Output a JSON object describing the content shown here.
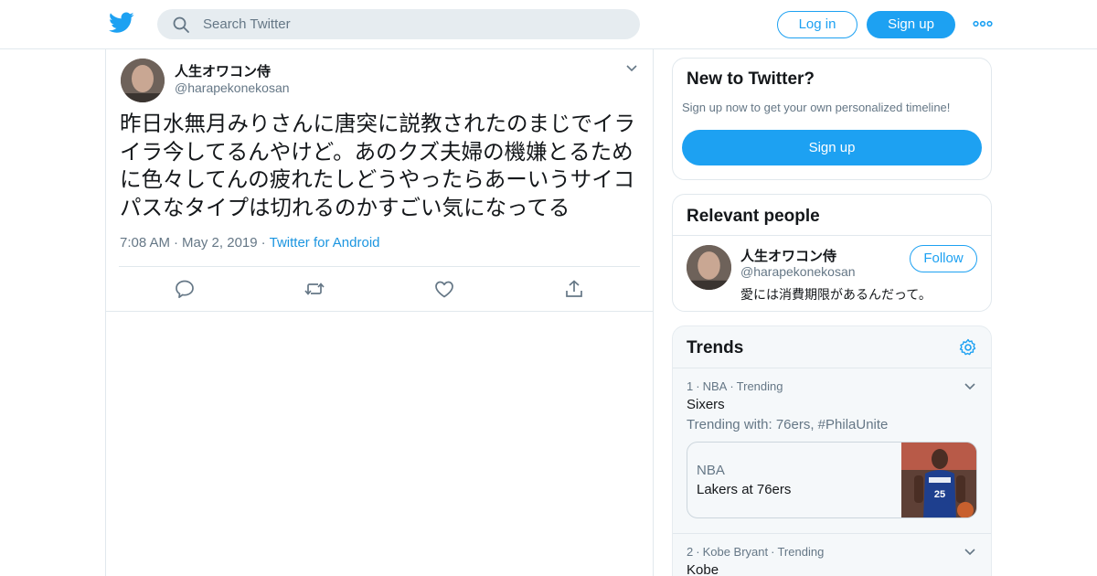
{
  "header": {
    "logo_icon": "twitter-bird-icon",
    "search": {
      "placeholder": "Search Twitter",
      "value": ""
    },
    "login_label": "Log in",
    "signup_label": "Sign up",
    "more_icon": "more-dots-icon"
  },
  "tweet": {
    "display_name": "人生オワコン侍",
    "handle": "@harapekonekosan",
    "text": "昨日水無月みりさんに唐突に説教されたのまじでイライラ今してるんやけど。あのクズ夫婦の機嫌とるために色々してんの疲れたしどうやったらあーいうサイコパスなタイプは切れるのかすごい気になってる",
    "time": "7:08 AM",
    "date": "May 2, 2019",
    "source": "Twitter for Android",
    "actions": [
      "reply-icon",
      "retweet-icon",
      "like-icon",
      "share-icon"
    ]
  },
  "sidebar": {
    "new_to_twitter": {
      "title": "New to Twitter?",
      "subtitle": "Sign up now to get your own personalized timeline!",
      "button_label": "Sign up"
    },
    "relevant_people": {
      "title": "Relevant people",
      "person": {
        "display_name": "人生オワコン侍",
        "handle": "@harapekonekosan",
        "bio": "愛には消費期限があるんだって。",
        "follow_label": "Follow"
      }
    },
    "trends": {
      "title": "Trends",
      "items": [
        {
          "rank": "1",
          "category": "NBA",
          "status": "Trending",
          "name": "Sixers",
          "trending_with": "Trending with: 76ers, #PhilaUnite",
          "story": {
            "category": "NBA",
            "headline": "Lakers at 76ers"
          }
        },
        {
          "rank": "2",
          "category": "Kobe Bryant",
          "status": "Trending",
          "name": "Kobe"
        }
      ]
    }
  },
  "colors": {
    "accent": "#1da1f2",
    "link": "#1b95e0",
    "text_primary": "#14171a",
    "text_secondary": "#657786",
    "border": "#e1e8ed",
    "trends_bg": "#f5f8fa"
  }
}
